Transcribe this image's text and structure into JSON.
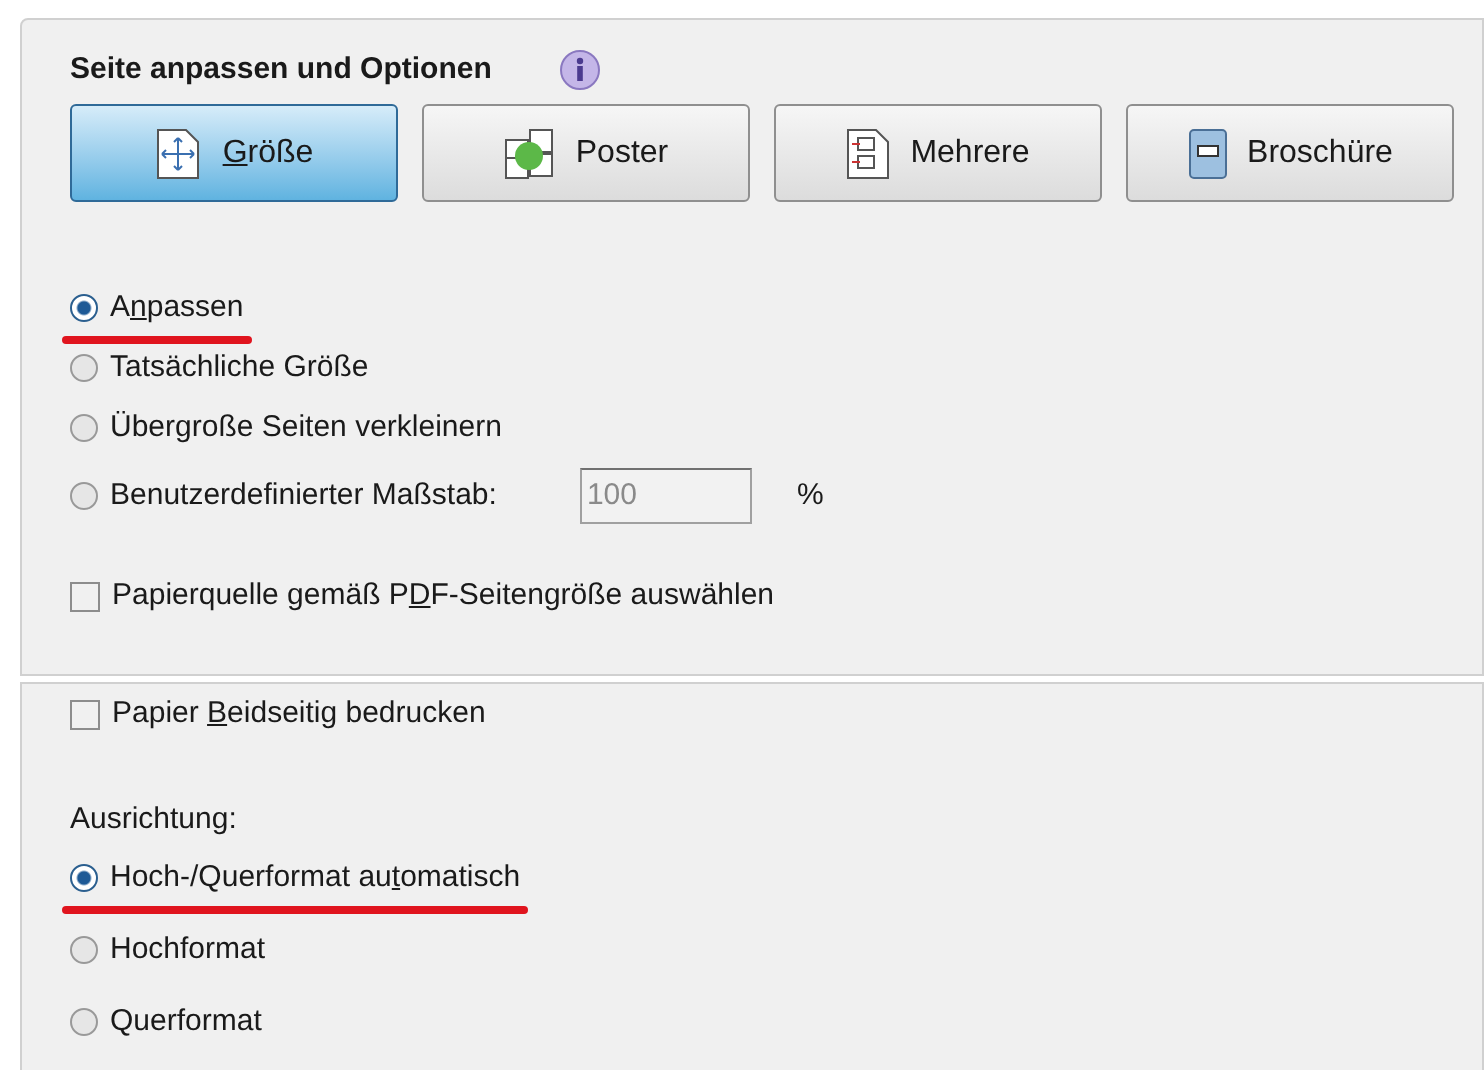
{
  "scaling_section": {
    "title": "Seite anpassen und Optionen",
    "modes": [
      {
        "kind": "size",
        "label": {
          "key": "G",
          "post": "röße"
        },
        "selected": true
      },
      {
        "kind": "poster",
        "label": "Poster",
        "selected": false
      },
      {
        "kind": "multiple",
        "label": "Mehrere",
        "selected": false
      },
      {
        "kind": "booklet",
        "label": "Broschüre",
        "selected": false
      }
    ],
    "options": [
      {
        "kind": "radio",
        "label": {
          "pre": "A",
          "key": "n",
          "post": "passen"
        },
        "selected": true,
        "highlighted": true
      },
      {
        "kind": "radio",
        "label": "Tatsächliche Größe",
        "selected": false,
        "highlighted": false
      },
      {
        "kind": "radio",
        "label": "Übergroße Seiten verkleinern",
        "selected": false,
        "highlighted": false
      },
      {
        "kind": "radio_field",
        "label": "Benutzerdefinierter Maßstab:",
        "selected": false,
        "highlighted": false,
        "value": "100",
        "unit": "%"
      },
      {
        "kind": "checkbox",
        "label": {
          "pre": "Papierquelle gemäß P",
          "key": "D",
          "post": "F-Seitengröße auswählen"
        },
        "checked": false,
        "highlighted": false
      }
    ]
  },
  "print_section": {
    "options": [
      {
        "kind": "checkbox",
        "label": {
          "pre": "Papier ",
          "key": "B",
          "post": "eidseitig bedrucken"
        },
        "checked": false,
        "highlighted": false
      }
    ],
    "orientation_label": "Ausrichtung:",
    "orientation": [
      {
        "kind": "radio",
        "label": {
          "pre": "Hoch-/Querformat au",
          "key": "t",
          "post": "omatisch"
        },
        "selected": true,
        "highlighted": true
      },
      {
        "kind": "radio",
        "label": "Hochformat",
        "selected": false,
        "highlighted": false
      },
      {
        "kind": "radio",
        "label": "Querformat",
        "selected": false,
        "highlighted": false
      }
    ]
  }
}
